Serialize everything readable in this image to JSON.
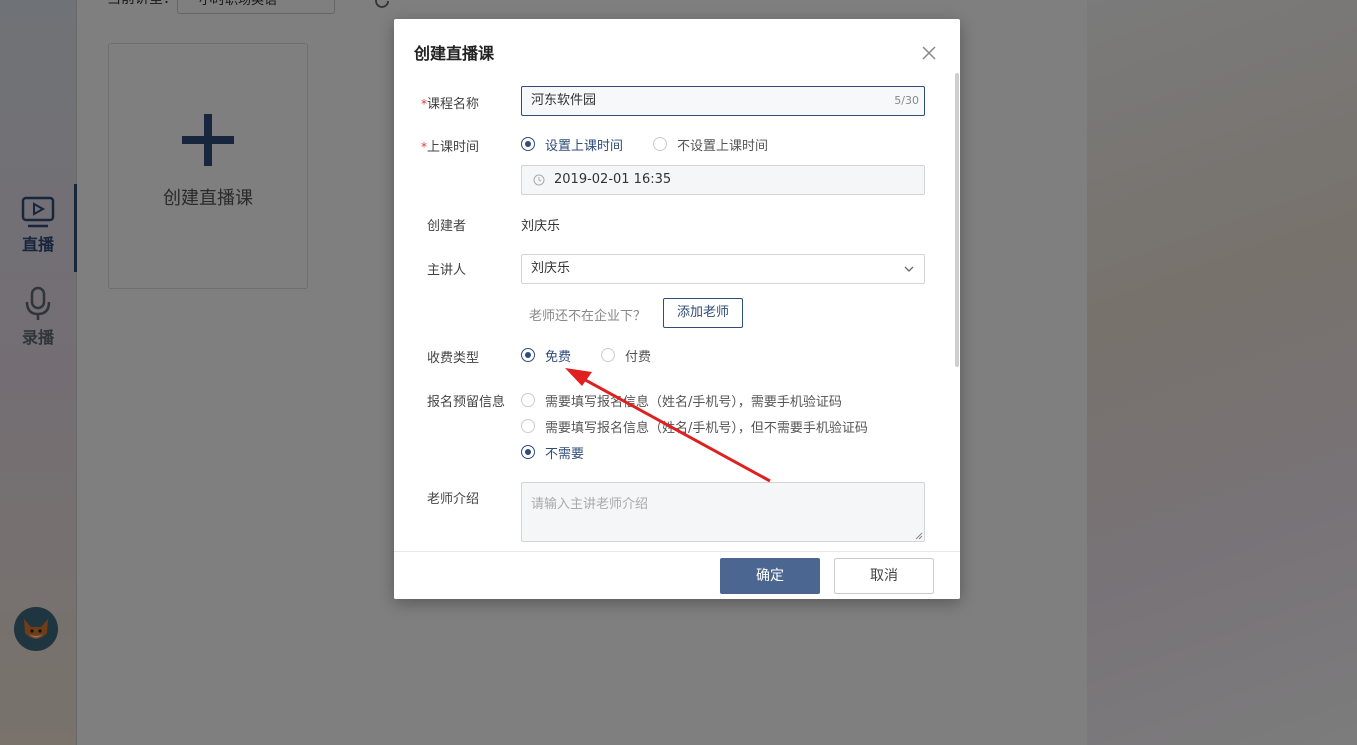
{
  "sidebar": {
    "items": [
      {
        "label": "直播",
        "icon": "video-play-icon",
        "active": true
      },
      {
        "label": "录播",
        "icon": "microphone-icon",
        "active": false
      }
    ]
  },
  "header": {
    "filter_label": "当前讲堂：",
    "filter_value": "一小时职场英语"
  },
  "main": {
    "create_card_label": "创建直播课"
  },
  "modal": {
    "title": "创建直播课",
    "course_name": {
      "label": "课程名称",
      "value": "河东软件园",
      "counter": "5/30"
    },
    "class_time": {
      "label": "上课时间",
      "options": [
        "设置上课时间",
        "不设置上课时间"
      ],
      "selected": "设置上课时间",
      "datetime": "2019-02-01 16:35"
    },
    "creator": {
      "label": "创建者",
      "value": "刘庆乐"
    },
    "lecturer": {
      "label": "主讲人",
      "value": "刘庆乐",
      "hint": "老师还不在企业下？",
      "add_button": "添加老师"
    },
    "fee_type": {
      "label": "收费类型",
      "options": [
        "免费",
        "付费"
      ],
      "selected": "免费"
    },
    "signup_info": {
      "label": "报名预留信息",
      "options": [
        "需要填写报名信息（姓名/手机号），需要手机验证码",
        "需要填写报名信息（姓名/手机号），但不需要手机验证码",
        "不需要"
      ],
      "selected": "不需要"
    },
    "teacher_intro": {
      "label": "老师介绍",
      "placeholder": "请输入主讲老师介绍"
    },
    "footer": {
      "confirm": "确定",
      "cancel": "取消"
    }
  },
  "colors": {
    "accent": "#2f4d7a",
    "confirm_button": "#4b6691",
    "annotation_arrow": "#e02020"
  }
}
